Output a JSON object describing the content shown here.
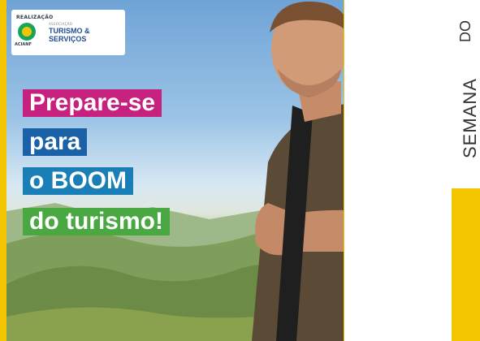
{
  "banner": {
    "headline_lines": [
      "Prepare-se",
      "para",
      "o BOOM",
      "do turismo!"
    ],
    "colors": {
      "frame": "#f2c500",
      "line_1_bg": "#c7217f",
      "line_2_bg": "#1b61a8",
      "line_3_bg": "#1b7fb7",
      "line_4_bg": "#49a842"
    }
  },
  "logo": {
    "label": "REALIZAÇÃO",
    "org": "ACIANF",
    "tagline": "ASSOCIAÇÃO",
    "title_line_1": "TURISMO &",
    "title_line_2": "SERVIÇOS"
  },
  "side": {
    "word_1": "DO",
    "word_2": "SEMANA"
  }
}
